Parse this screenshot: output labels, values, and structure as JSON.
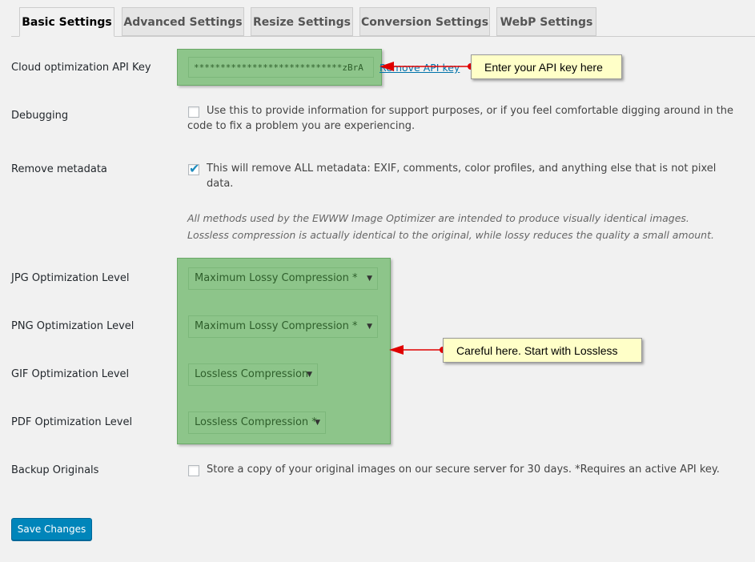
{
  "tabs": [
    {
      "label": "Basic Settings"
    },
    {
      "label": "Advanced Settings"
    },
    {
      "label": "Resize Settings"
    },
    {
      "label": "Conversion Settings"
    },
    {
      "label": "WebP Settings"
    }
  ],
  "api_key": {
    "label": "Cloud optimization API Key",
    "value": "****************************zBrA",
    "remove_link": "Remove API key"
  },
  "debugging": {
    "label": "Debugging",
    "checked": false,
    "description": "Use this to provide information for support purposes, or if you feel comfortable digging around in the code to fix a problem you are experiencing."
  },
  "remove_metadata": {
    "label": "Remove metadata",
    "checked": true,
    "description": "This will remove ALL metadata: EXIF, comments, color profiles, and anything else that is not pixel data."
  },
  "note": "All methods used by the EWWW Image Optimizer are intended to produce visually identical images. Lossless compression is actually identical to the original, while lossy reduces the quality a small amount.",
  "levels": {
    "jpg": {
      "label": "JPG Optimization Level",
      "value": "Maximum Lossy Compression *"
    },
    "png": {
      "label": "PNG Optimization Level",
      "value": "Maximum Lossy Compression *"
    },
    "gif": {
      "label": "GIF Optimization Level",
      "value": "Lossless Compression"
    },
    "pdf": {
      "label": "PDF Optimization Level",
      "value": "Lossless Compression *"
    }
  },
  "backup": {
    "label": "Backup Originals",
    "checked": false,
    "description": "Store a copy of your original images on our secure server for 30 days. *Requires an active API key."
  },
  "callouts": {
    "api": "Enter your API key here",
    "levels": "Careful here. Start with Lossless"
  },
  "save_label": "Save Changes",
  "colors": {
    "highlight": "#8dc58a",
    "callout_bg": "#ffffc8",
    "arrow": "#e00000",
    "button": "#0085ba"
  }
}
